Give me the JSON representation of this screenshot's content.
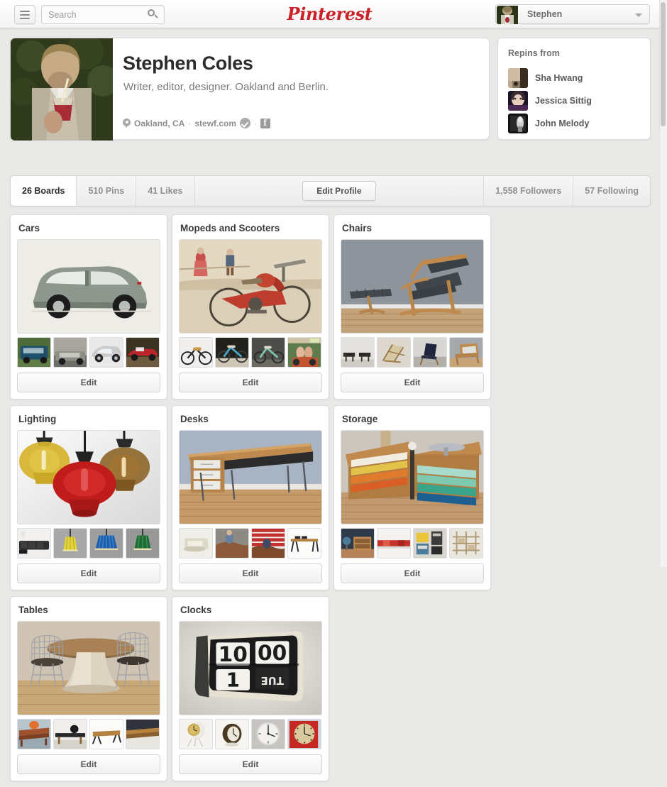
{
  "topbar": {
    "menu_icon": "hamburger-icon",
    "search": {
      "value": "",
      "placeholder": "Search",
      "icon": "search-icon"
    },
    "brand": "Pinterest",
    "brand_color": "#cb2027",
    "user": {
      "name": "Stephen",
      "caret_icon": "chevron-down-icon"
    }
  },
  "profile": {
    "name": "Stephen Coles",
    "bio": "Writer, editor, designer. Oakland and Berlin.",
    "location": "Oakland, CA",
    "separator": "·",
    "website": "stewf.com",
    "verified_icon": "verified-check-icon",
    "facebook_icon": "facebook-icon",
    "location_icon": "map-pin-icon"
  },
  "repins": {
    "title": "Repins from",
    "people": [
      {
        "name": "Sha Hwang"
      },
      {
        "name": "Jessica Sittig"
      },
      {
        "name": "John Melody"
      }
    ]
  },
  "stats": {
    "boards": "26 Boards",
    "pins": "510 Pins",
    "likes": "41 Likes",
    "edit_profile": "Edit Profile",
    "followers": "1,558 Followers",
    "following": "57 Following"
  },
  "boards": [
    {
      "title": "Cars",
      "edit": "Edit"
    },
    {
      "title": "Mopeds and Scooters",
      "edit": "Edit"
    },
    {
      "title": "Chairs",
      "edit": "Edit"
    },
    {
      "title": "Lighting",
      "edit": "Edit"
    },
    {
      "title": "Desks",
      "edit": "Edit"
    },
    {
      "title": "Storage",
      "edit": "Edit"
    },
    {
      "title": "Tables",
      "edit": "Edit"
    },
    {
      "title": "Clocks",
      "edit": "Edit"
    }
  ]
}
